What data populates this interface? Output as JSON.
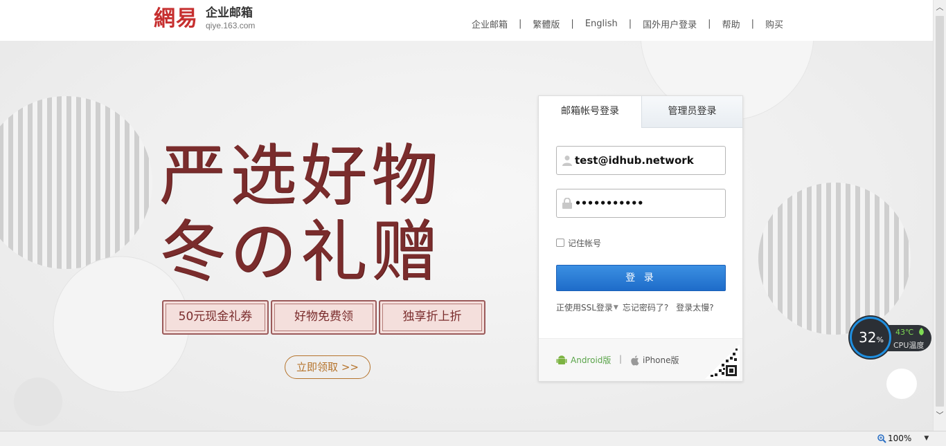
{
  "header": {
    "logo_mark": "網易",
    "logo_title": "企业邮箱",
    "logo_domain": "qiye.163.com",
    "nav": [
      "企业邮箱",
      "繁體版",
      "English",
      "国外用户登录",
      "帮助",
      "购买"
    ],
    "separator": "|"
  },
  "hero": {
    "slogan_line1": "严选好物",
    "slogan_line2": "冬の礼赠",
    "badges": [
      "50元现金礼券",
      "好物免费领",
      "独享折上折"
    ],
    "cta": "立即领取 >>"
  },
  "login": {
    "tabs": [
      "邮箱帐号登录",
      "管理员登录"
    ],
    "username_value": "test@idhub.network",
    "password_value": "•••••••••••",
    "remember_label": "记住帐号",
    "submit_label": "登 录",
    "links": {
      "ssl": "正使用SSL登录",
      "forgot": "忘记密码了?",
      "slow": "登录太慢?"
    },
    "apps": {
      "android": "Android版",
      "iphone": "iPhone版",
      "separator": "|"
    }
  },
  "cpu_widget": {
    "percent": "32",
    "percent_unit": "%",
    "temperature": "43℃",
    "label": "CPU温度"
  },
  "statusbar": {
    "zoom": "100%"
  },
  "colors": {
    "brand_red": "#c62f2f",
    "slogan": "#7a2c2c",
    "button_blue": "#1e6cc9",
    "cta_gold": "#b5732b",
    "android_green": "#5aa44a"
  }
}
